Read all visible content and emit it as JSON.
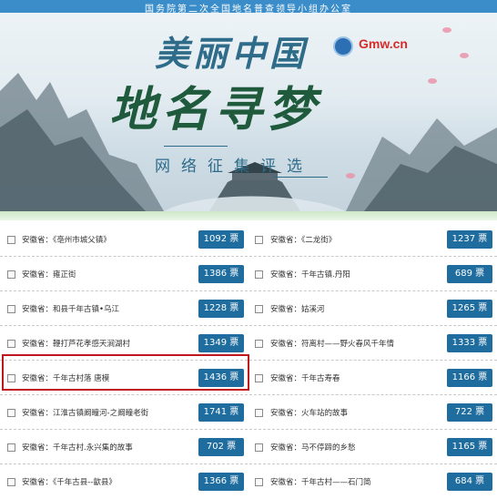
{
  "header": {
    "office": "国务院第二次全国地名普查领导小组办公室",
    "title_line1": "美丽中国",
    "title_line2": "地名寻梦",
    "subtitle": "网络征集评选",
    "partner_logo_text": "Gmw.cn"
  },
  "items": [
    {
      "left": {
        "name": "安徽省：《亳州市城父镇》",
        "votes": "1092 票"
      },
      "right": {
        "name": "安徽省：《二龙街》",
        "votes": "1237 票"
      }
    },
    {
      "left": {
        "name": "安徽省：雍正街",
        "votes": "1386 票"
      },
      "right": {
        "name": "安徽省：千年古镇.丹阳",
        "votes": "689 票"
      }
    },
    {
      "left": {
        "name": "安徽省：和县千年古镇•乌江",
        "votes": "1228 票"
      },
      "right": {
        "name": "安徽省：姑溪河",
        "votes": "1265 票"
      }
    },
    {
      "left": {
        "name": "安徽省：鞭打芦花孝感天涧湖村",
        "votes": "1349 票"
      },
      "right": {
        "name": "安徽省：符离村——野火春风千年情",
        "votes": "1333 票"
      }
    },
    {
      "left": {
        "name": "安徽省：千年古村落 唐模",
        "votes": "1436 票"
      },
      "right": {
        "name": "安徽省：千年古寿春",
        "votes": "1166 票"
      }
    },
    {
      "left": {
        "name": "安徽省：江淮古镇阚疃河-之阚疃老街",
        "votes": "1741 票"
      },
      "right": {
        "name": "安徽省：火车站的故事",
        "votes": "722 票"
      }
    },
    {
      "left": {
        "name": "安徽省：千年古村.永兴集的故事",
        "votes": "702 票"
      },
      "right": {
        "name": "安徽省：马不停蹄的乡愁",
        "votes": "1165 票"
      }
    },
    {
      "left": {
        "name": "安徽省：《千年古县--歙县》",
        "votes": "1366 票"
      },
      "right": {
        "name": "安徽省：千年古村——石门简",
        "votes": "684 票"
      }
    }
  ],
  "colors": {
    "vote_button": "#1f6c9e",
    "highlight": "#c0161d",
    "topbar": "#3a8dc9"
  }
}
